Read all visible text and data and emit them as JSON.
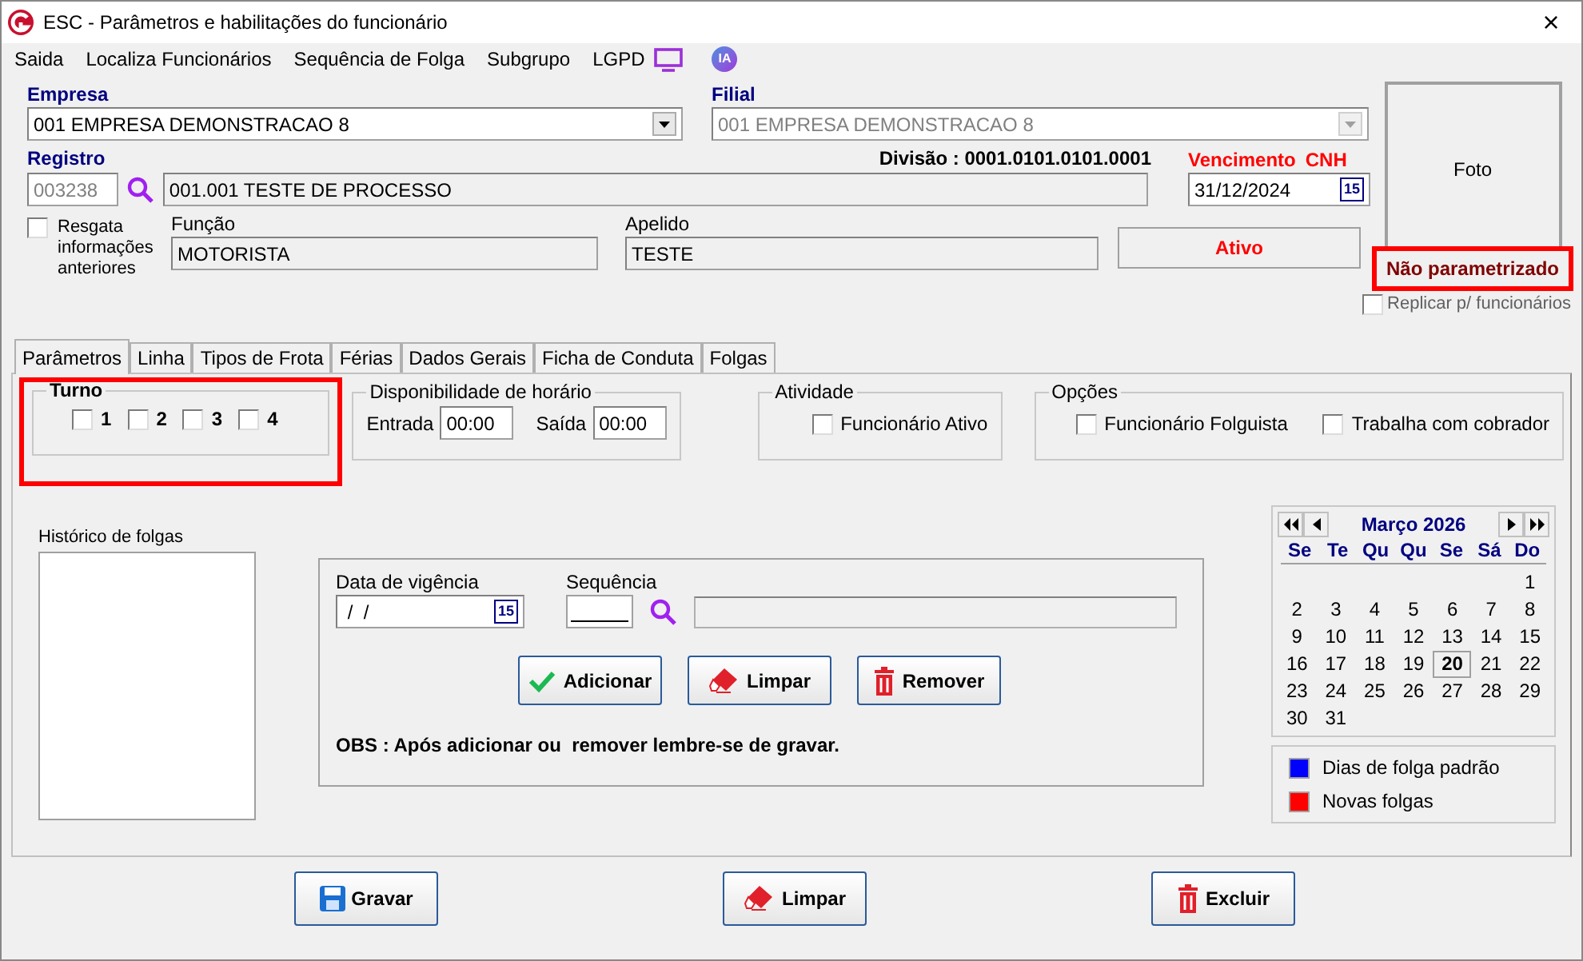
{
  "window": {
    "title": "ESC - Parâmetros e habilitações do funcionário",
    "close": "×"
  },
  "menu": [
    {
      "label": "Saida"
    },
    {
      "label": "Localiza Funcionários"
    },
    {
      "label": "Sequência de Folga"
    },
    {
      "label": "Subgrupo"
    },
    {
      "label": "LGPD"
    }
  ],
  "ia_badge": "IA",
  "header": {
    "empresa": {
      "label": "Empresa",
      "value": "001 EMPRESA DEMONSTRACAO 8"
    },
    "filial": {
      "label": "Filial",
      "value": "001 EMPRESA DEMONSTRACAO 8",
      "disabled": true
    },
    "registro": {
      "label": "Registro",
      "code": "003238",
      "name": "001.001 TESTE DE PROCESSO"
    },
    "divisao": "Divisão : 0001.0101.0101.0001",
    "vencimento": {
      "label": "Vencimento",
      "label_2": "CNH",
      "value": "31/12/2024",
      "picker": "15"
    },
    "resgata": {
      "label": "Resgata informações anteriores",
      "checked": false
    },
    "funcao": {
      "label": "Função",
      "value": "MOTORISTA"
    },
    "apelido": {
      "label": "Apelido",
      "value": "TESTE"
    },
    "status": "Ativo",
    "foto": "Foto",
    "parametrizacao": {
      "text": "Não parametrizado",
      "highlighted": true
    },
    "replicar": {
      "label": "Replicar p/ funcionários",
      "checked": false
    }
  },
  "tabs": [
    {
      "label": "Parâmetros",
      "selected": true
    },
    {
      "label": "Linha",
      "selected": false
    },
    {
      "label": "Tipos de Frota",
      "selected": false
    },
    {
      "label": "Férias",
      "selected": false
    },
    {
      "label": "Dados Gerais",
      "selected": false
    },
    {
      "label": "Ficha de Conduta",
      "selected": false
    },
    {
      "label": "Folgas",
      "selected": false
    }
  ],
  "turno": {
    "title": "Turno",
    "highlighted": true,
    "options": [
      {
        "label": "1",
        "checked": false
      },
      {
        "label": "2",
        "checked": false
      },
      {
        "label": "3",
        "checked": false
      },
      {
        "label": "4",
        "checked": false
      }
    ]
  },
  "disponibilidade": {
    "title": "Disponibilidade de horário",
    "entrada": {
      "label": "Entrada",
      "value": "00:00"
    },
    "saida": {
      "label": "Saída",
      "value": "00:00"
    }
  },
  "atividade": {
    "title": "Atividade",
    "options": [
      {
        "label": "Funcionário Ativo",
        "checked": false
      }
    ]
  },
  "opcoes": {
    "title": "Opções",
    "options": [
      {
        "label": "Funcionário Folguista",
        "checked": false
      },
      {
        "label": "Trabalha com cobrador",
        "checked": false
      }
    ]
  },
  "historico": {
    "label": "Histórico de folgas"
  },
  "vigencia": {
    "data": {
      "label": "Data de vigência",
      "value": " /  /",
      "picker": "15"
    },
    "sequencia": {
      "label": "Sequência"
    },
    "buttons": [
      {
        "label": "Adicionar",
        "kind": "add"
      },
      {
        "label": "Limpar",
        "kind": "clear"
      },
      {
        "label": "Remover",
        "kind": "remove"
      }
    ],
    "obs": "OBS : Após adicionar ou  remover lembre-se de gravar."
  },
  "calendar": {
    "month": "Março 2026",
    "weekdays": [
      "Se",
      "Te",
      "Qu",
      "Qu",
      "Se",
      "Sá",
      "Do"
    ],
    "weeks": [
      [
        {
          "day": "1",
          "selected": false
        }
      ],
      [
        {
          "day": "2",
          "selected": false
        },
        {
          "day": "3",
          "selected": false
        },
        {
          "day": "4",
          "selected": false
        },
        {
          "day": "5",
          "selected": false
        },
        {
          "day": "6",
          "selected": false
        },
        {
          "day": "7",
          "selected": false
        },
        {
          "day": "8",
          "selected": false
        }
      ],
      [
        {
          "day": "9",
          "selected": false
        },
        {
          "day": "10",
          "selected": false
        },
        {
          "day": "11",
          "selected": false
        },
        {
          "day": "12",
          "selected": false
        },
        {
          "day": "13",
          "selected": false
        },
        {
          "day": "14",
          "selected": false
        },
        {
          "day": "15",
          "selected": false
        }
      ],
      [
        {
          "day": "16",
          "selected": false
        },
        {
          "day": "17",
          "selected": false
        },
        {
          "day": "18",
          "selected": false
        },
        {
          "day": "19",
          "selected": false
        },
        {
          "day": "20",
          "selected": true
        },
        {
          "day": "21",
          "selected": false
        },
        {
          "day": "22",
          "selected": false
        }
      ],
      [
        {
          "day": "23",
          "selected": false
        },
        {
          "day": "24",
          "selected": false
        },
        {
          "day": "25",
          "selected": false
        },
        {
          "day": "26",
          "selected": false
        },
        {
          "day": "27",
          "selected": false
        },
        {
          "day": "28",
          "selected": false
        },
        {
          "day": "29",
          "selected": false
        }
      ],
      [
        {
          "day": "30",
          "selected": false
        },
        {
          "day": "31",
          "selected": false
        }
      ]
    ],
    "legend": [
      {
        "label": "Dias de folga padrão",
        "color": "#0000ff"
      },
      {
        "label": "Novas folgas",
        "color": "#ff0000"
      }
    ]
  },
  "footer": [
    {
      "label": "Gravar",
      "kind": "save"
    },
    {
      "label": "Limpar",
      "kind": "clear"
    },
    {
      "label": "Excluir",
      "kind": "delete"
    }
  ]
}
